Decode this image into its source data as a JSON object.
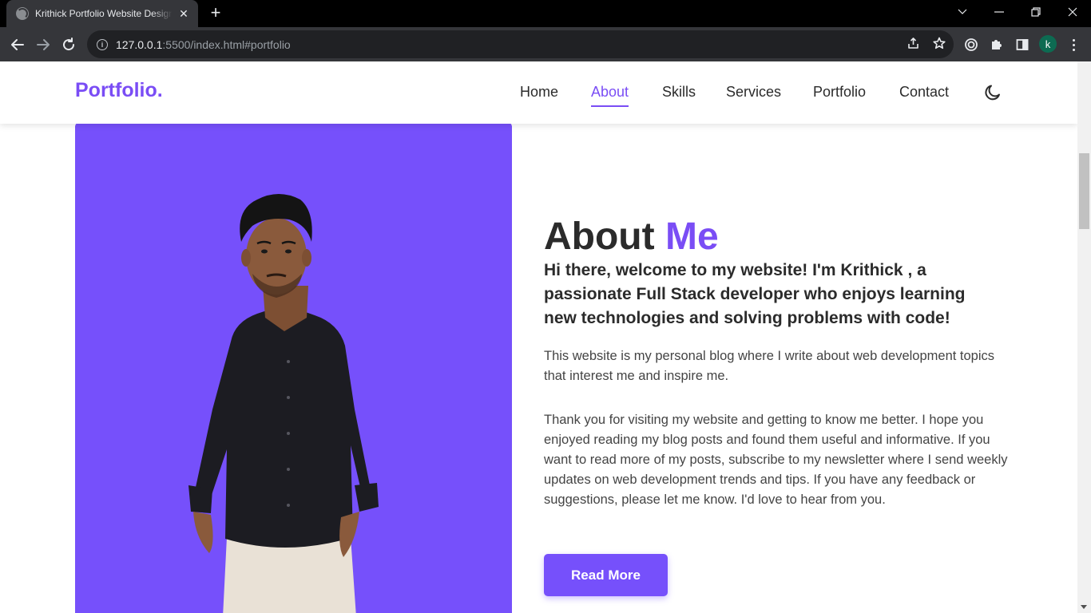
{
  "browser": {
    "tab_title": "Krithick Portfolio Website Design",
    "url_host": "127.0.0.1",
    "url_rest": ":5500/index.html#portfolio",
    "profile_initial": "k"
  },
  "site": {
    "logo": "Portfolio.",
    "nav": [
      {
        "label": "Home"
      },
      {
        "label": "About",
        "active": true
      },
      {
        "label": "Skills"
      },
      {
        "label": "Services"
      },
      {
        "label": "Portfolio"
      },
      {
        "label": "Contact"
      }
    ],
    "theme_toggle_icon": "moon-icon"
  },
  "about": {
    "title_main": "About",
    "title_accent": "Me",
    "intro": "Hi there, welcome to my website! I'm Krithick , a passionate Full Stack developer who enjoys learning new technologies and solving problems with code!",
    "paragraph1": "This website is my personal blog where I write about web development topics that interest me and inspire me.",
    "paragraph2": "Thank you for visiting my website and getting to know me better. I hope you enjoyed reading my blog posts and found them useful and informative. If you want to read more of my posts, subscribe to my newsletter where I send weekly updates on web development trends and tips. If you have any feedback or suggestions, please let me know. I'd love to hear from you.",
    "button_label": "Read More"
  },
  "colors": {
    "accent": "#7a4df5",
    "panel": "#7650fb",
    "text": "#2b2b2b"
  }
}
